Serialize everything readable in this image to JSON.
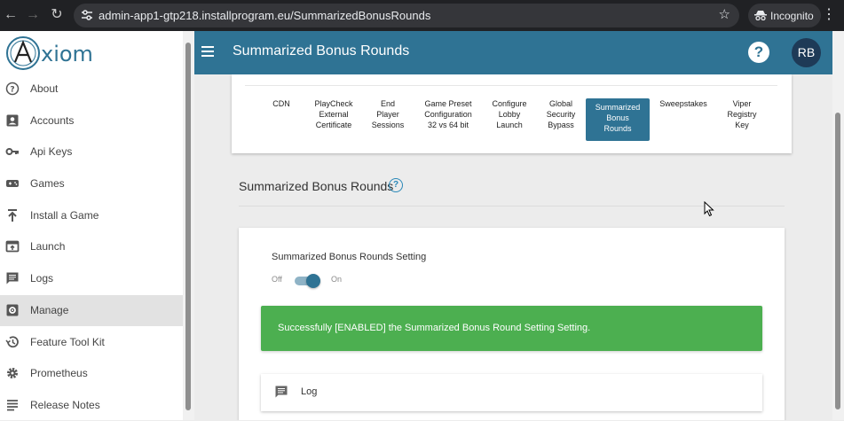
{
  "browser": {
    "url": "admin-app1-gtp218.installprogram.eu/SummarizedBonusRounds",
    "incognito_label": "Incognito"
  },
  "sidebar": {
    "logo_text": "xiom",
    "items": [
      {
        "label": "About",
        "icon": "help-circle-icon"
      },
      {
        "label": "Accounts",
        "icon": "account-box-icon"
      },
      {
        "label": "Api Keys",
        "icon": "key-icon"
      },
      {
        "label": "Games",
        "icon": "gamepad-icon"
      },
      {
        "label": "Install a Game",
        "icon": "upload-icon"
      },
      {
        "label": "Launch",
        "icon": "launch-icon"
      },
      {
        "label": "Logs",
        "icon": "message-icon"
      },
      {
        "label": "Manage",
        "icon": "gear-box-icon",
        "active": true
      },
      {
        "label": "Feature Tool Kit",
        "icon": "history-icon"
      },
      {
        "label": "Prometheus",
        "icon": "settings-icon"
      },
      {
        "label": "Release Notes",
        "icon": "notes-icon"
      }
    ]
  },
  "header": {
    "title": "Summarized Bonus Rounds",
    "help_icon": "?",
    "user_initials": "RB"
  },
  "tabs": [
    {
      "lines": [
        "CDN"
      ]
    },
    {
      "lines": [
        "PlayCheck",
        "External",
        "Certificate"
      ]
    },
    {
      "lines": [
        "End",
        "Player",
        "Sessions"
      ]
    },
    {
      "lines": [
        "Game Preset",
        "Configuration",
        "32 vs 64 bit"
      ]
    },
    {
      "lines": [
        "Configure",
        "Lobby",
        "Launch"
      ]
    },
    {
      "lines": [
        "Global",
        "Security",
        "Bypass"
      ]
    },
    {
      "lines": [
        "Summarized",
        "Bonus",
        "Rounds"
      ],
      "active": true
    },
    {
      "lines": [
        "Sweepstakes"
      ]
    },
    {
      "lines": [
        "Viper",
        "Registry",
        "Key"
      ]
    }
  ],
  "section": {
    "title": "Summarized Bonus Rounds",
    "help_icon": "?"
  },
  "setting": {
    "label": "Summarized Bonus Rounds Setting",
    "off_label": "Off",
    "on_label": "On",
    "enabled": true
  },
  "alert": {
    "message": "Successfully [ENABLED] the Summarized Bonus Round Setting Setting."
  },
  "log": {
    "label": "Log"
  },
  "colors": {
    "primary": "#2f7394",
    "success": "#4caf50",
    "avatar": "#1e3a57"
  }
}
